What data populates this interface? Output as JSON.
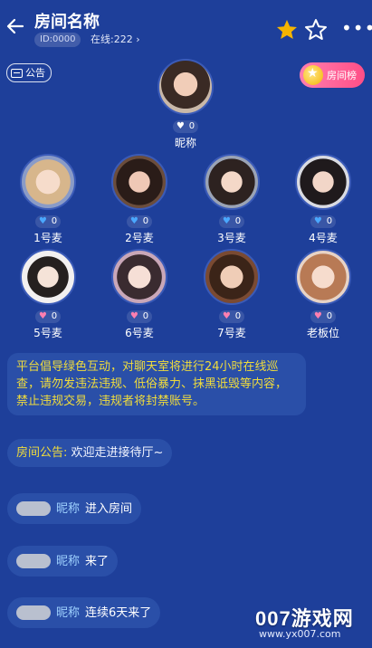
{
  "header": {
    "title": "房间名称",
    "room_id": "ID:0000",
    "online": "在线:222",
    "online_arrow": "›",
    "more": "•••"
  },
  "notice_button": {
    "label": "公告"
  },
  "rank_button": {
    "label": "房间榜"
  },
  "host": {
    "name": "昵称",
    "hearts": "0"
  },
  "seats_row1": [
    {
      "name": "1号麦",
      "hearts": "0"
    },
    {
      "name": "2号麦",
      "hearts": "0"
    },
    {
      "name": "3号麦",
      "hearts": "0"
    },
    {
      "name": "4号麦",
      "hearts": "0"
    }
  ],
  "seats_row2": [
    {
      "name": "5号麦",
      "hearts": "0"
    },
    {
      "name": "6号麦",
      "hearts": "0"
    },
    {
      "name": "7号麦",
      "hearts": "0"
    },
    {
      "name": "老板位",
      "hearts": "0"
    }
  ],
  "messages": {
    "system": "平台倡导绿色互动，对聊天室将进行24小时在线巡查，请勿发违法违规、低俗暴力、抹黑诋毁等内容，禁止违规交易，违规者将封禁账号。",
    "announcement_key": "房间公告:",
    "announcement_value": "欢迎走进接待厅~",
    "events": [
      {
        "nick": "昵称",
        "text": "进入房间"
      },
      {
        "nick": "昵称",
        "text": "来了"
      },
      {
        "nick": "昵称",
        "text": "连续6天来了"
      }
    ]
  },
  "watermark": {
    "brand": "007游戏网",
    "url": "www.yx007.com"
  },
  "colors": {
    "bg": "#1e3f9a",
    "bubble": "#2a4fa8",
    "system_text": "#f0dc3c",
    "star": "#f5b400",
    "rank_pink": "#ff4e86"
  }
}
